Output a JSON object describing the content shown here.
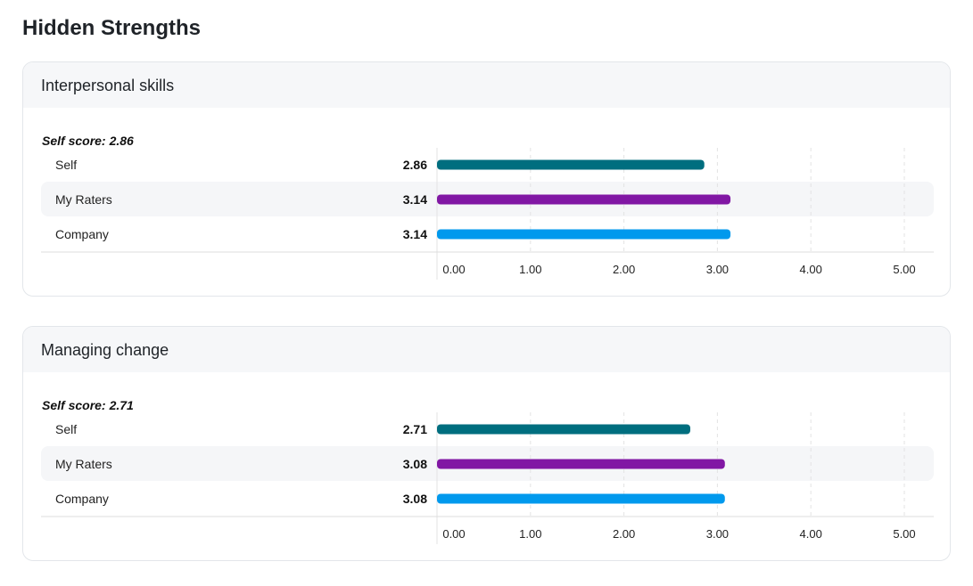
{
  "page": {
    "title": "Hidden Strengths"
  },
  "colors": {
    "self": "#006e7f",
    "raters": "#8117a4",
    "company": "#0099ed",
    "stripe": "#f5f6f8",
    "grid": "#e3e3e3",
    "axis": "#dcdcdc"
  },
  "chart_data": [
    {
      "type": "bar",
      "orientation": "horizontal",
      "title": "Interpersonal skills",
      "self_score_label": "Self score:",
      "self_score_value": "2.86",
      "categories": [
        "Self",
        "My Raters",
        "Company"
      ],
      "values": [
        2.86,
        3.14,
        3.14
      ],
      "value_labels": [
        "2.86",
        "3.14",
        "3.14"
      ],
      "xlim": [
        0,
        5
      ],
      "ticks": [
        0,
        1,
        2,
        3,
        4,
        5
      ],
      "tick_labels": [
        "0.00",
        "1.00",
        "2.00",
        "3.00",
        "4.00",
        "5.00"
      ],
      "grid": true
    },
    {
      "type": "bar",
      "orientation": "horizontal",
      "title": "Managing change",
      "self_score_label": "Self score:",
      "self_score_value": "2.71",
      "categories": [
        "Self",
        "My Raters",
        "Company"
      ],
      "values": [
        2.71,
        3.08,
        3.08
      ],
      "value_labels": [
        "2.71",
        "3.08",
        "3.08"
      ],
      "xlim": [
        0,
        5
      ],
      "ticks": [
        0,
        1,
        2,
        3,
        4,
        5
      ],
      "tick_labels": [
        "0.00",
        "1.00",
        "2.00",
        "3.00",
        "4.00",
        "5.00"
      ],
      "grid": true
    }
  ]
}
